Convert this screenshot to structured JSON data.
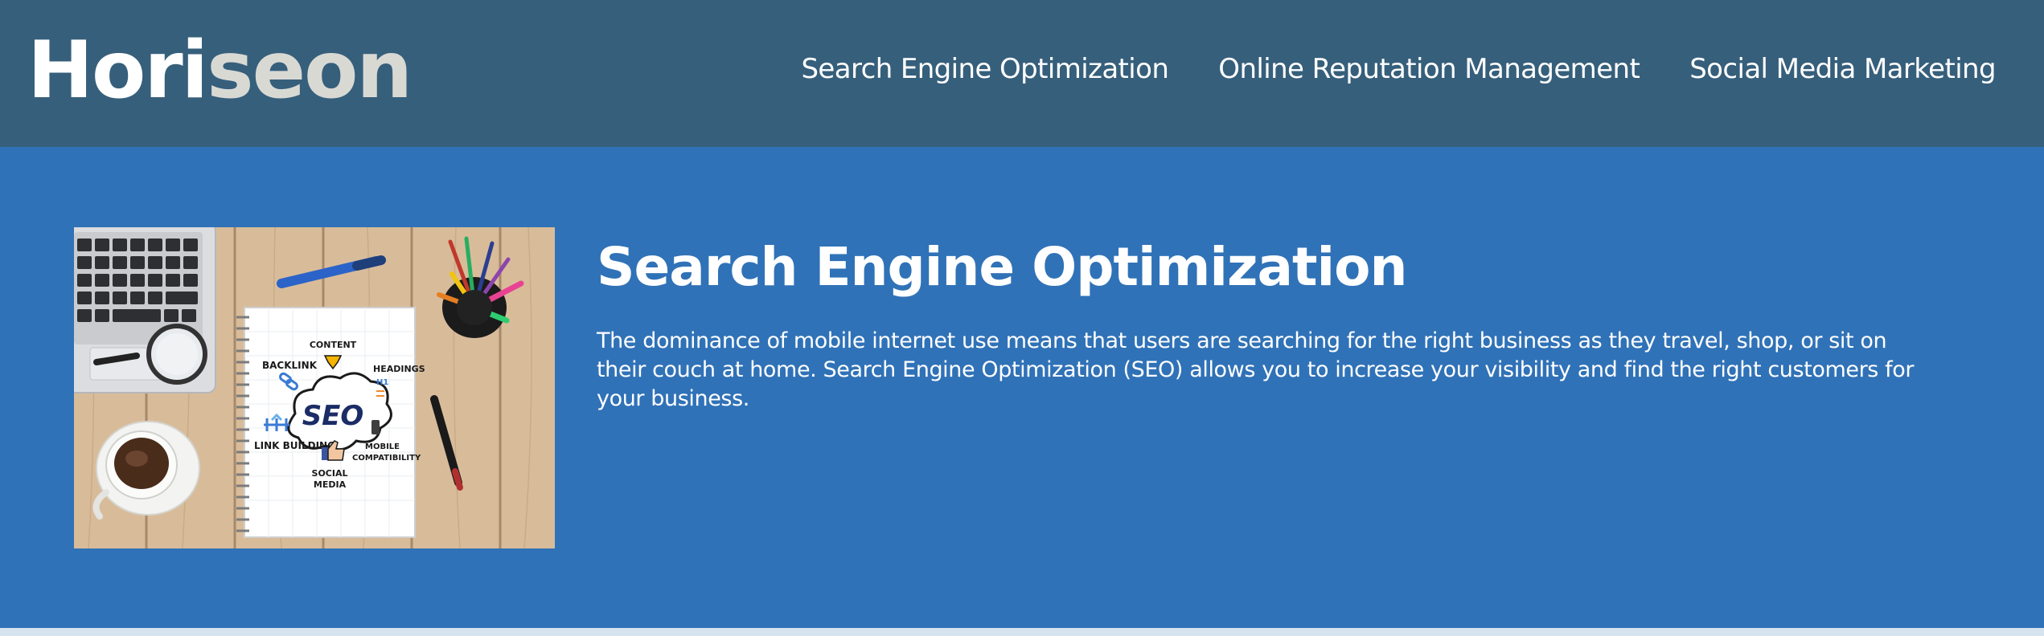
{
  "header": {
    "logo": {
      "part1": "Hori",
      "part2": "seon"
    },
    "nav": [
      {
        "label": "Search Engine Optimization"
      },
      {
        "label": "Online Reputation Management"
      },
      {
        "label": "Social Media Marketing"
      }
    ]
  },
  "hero": {
    "image_labels": {
      "seo": "SEO",
      "content": "CONTENT",
      "backlink": "BACKLINK",
      "headings": "HEADINGS",
      "h1": "H1",
      "link_building": "LINK BUILDING",
      "mobile": "MOBILE",
      "compat": "COMPATIBILITY",
      "social": "SOCIAL",
      "media": "MEDIA"
    },
    "title": "Search Engine Optimization",
    "body": "The dominance of mobile internet use means that users are searching for the right business as they travel, shop, or sit on their couch at home. Search Engine Optimization (SEO) allows you to increase your visibility and find the right customers for your business."
  },
  "colors": {
    "header_bg": "#365f7b",
    "hero_bg": "#3072b7",
    "logo_accent": "#d9d9d4",
    "page_bg": "#d6e4f0"
  }
}
